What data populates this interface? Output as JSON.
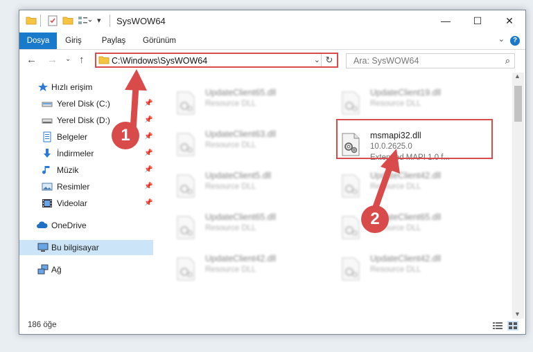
{
  "window": {
    "title": "SysWOW64",
    "controls": {
      "minimize": "—",
      "maximize": "☐",
      "close": "✕"
    }
  },
  "ribbon": {
    "tabs": [
      {
        "label": "Dosya",
        "active": true
      },
      {
        "label": "Giriş"
      },
      {
        "label": "Paylaş"
      },
      {
        "label": "Görünüm"
      }
    ],
    "help": "?"
  },
  "address": {
    "path": "C:\\Windows\\SysWOW64"
  },
  "search": {
    "placeholder": "Ara: SysWOW64"
  },
  "nav": {
    "items": [
      {
        "label": "Hızlı erişim",
        "icon": "star-icon"
      },
      {
        "label": "Yerel Disk (C:)",
        "icon": "drive-icon",
        "pinned": true
      },
      {
        "label": "Yerel Disk (D:)",
        "icon": "drive-icon",
        "pinned": true
      },
      {
        "label": "Belgeler",
        "icon": "documents-icon",
        "pinned": true
      },
      {
        "label": "İndirmeler",
        "icon": "download-icon",
        "pinned": true
      },
      {
        "label": "Müzik",
        "icon": "music-icon",
        "pinned": true
      },
      {
        "label": "Resimler",
        "icon": "pictures-icon",
        "pinned": true
      },
      {
        "label": "Videolar",
        "icon": "video-icon",
        "pinned": true
      },
      {
        "label": "OneDrive",
        "icon": "cloud-icon"
      },
      {
        "label": "Bu bilgisayar",
        "icon": "computer-icon",
        "selected": true
      },
      {
        "label": "Ağ",
        "icon": "network-icon"
      }
    ]
  },
  "files": {
    "left": [
      {
        "name": "UpdateClient65.dll",
        "type": "Resource DLL"
      },
      {
        "name": "UpdateClient63.dll",
        "type": "Resource DLL"
      },
      {
        "name": "UpdateClient5.dll",
        "type": "Resource DLL"
      },
      {
        "name": "UpdateClient65.dll",
        "type": "Resource DLL"
      },
      {
        "name": "UpdateClient42.dll",
        "type": "Resource DLL"
      }
    ],
    "right_top": {
      "name": "UpdateClient19.dll",
      "type": "Resource DLL"
    },
    "highlighted": {
      "name": "msmapi32.dll",
      "version": "10.0.2625.0",
      "description": "Extended MAPI 1.0 f..."
    },
    "right": [
      {
        "name": "UpdateClient42.dll",
        "type": "Resource DLL"
      },
      {
        "name": "UpdateClient65.dll",
        "type": "Resource DLL"
      },
      {
        "name": "UpdateClient42.dll",
        "type": "Resource DLL"
      }
    ]
  },
  "status": {
    "count": "186 öğe"
  },
  "markers": {
    "one": "1",
    "two": "2"
  },
  "colors": {
    "accent": "#1979ca",
    "annotation": "#d94a4a",
    "selection": "#cce4f7"
  }
}
